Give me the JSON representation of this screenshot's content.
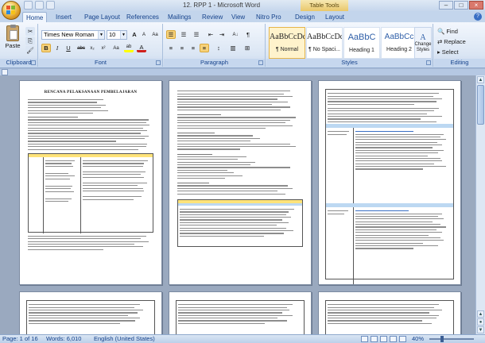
{
  "window": {
    "title": "12. RPP 1 - Microsoft Word",
    "contextual_tab": "Table Tools"
  },
  "tabs": [
    {
      "label": "Home"
    },
    {
      "label": "Insert"
    },
    {
      "label": "Page Layout"
    },
    {
      "label": "References"
    },
    {
      "label": "Mailings"
    },
    {
      "label": "Review"
    },
    {
      "label": "View"
    },
    {
      "label": "Nitro Pro"
    },
    {
      "label": "Design"
    },
    {
      "label": "Layout"
    }
  ],
  "ribbon": {
    "clipboard": {
      "label": "Clipboard",
      "paste": "Paste"
    },
    "font": {
      "label": "Font",
      "font_name": "Times New Roman",
      "font_size": "10",
      "bold": "B",
      "italic": "I",
      "underline": "U",
      "grow": "A",
      "shrink": "A",
      "clear": "Aa",
      "highlight": "ab",
      "color": "A"
    },
    "paragraph": {
      "label": "Paragraph"
    },
    "styles": {
      "label": "Styles",
      "items": [
        {
          "sample": "AaBbCcDc",
          "name": "¶ Normal"
        },
        {
          "sample": "AaBbCcDc",
          "name": "¶ No Spaci..."
        },
        {
          "sample": "AaBbC",
          "name": "Heading 1"
        },
        {
          "sample": "AaBbCc",
          "name": "Heading 2"
        }
      ],
      "change_styles": "Change Styles"
    },
    "editing": {
      "label": "Editing",
      "find": "Find",
      "replace": "Replace",
      "select": "Select"
    }
  },
  "document": {
    "page1_title": "RENCANA PELAKSANAAN PEMBELAJARAN"
  },
  "status": {
    "page": "Page: 1 of 16",
    "words": "Words: 6,010",
    "language": "English (United States)",
    "zoom": "40%"
  },
  "colors": {
    "office_blue": "#15428b",
    "table_header_yellow": "#ffe37a",
    "table_header_blue": "#bcd8f2"
  }
}
